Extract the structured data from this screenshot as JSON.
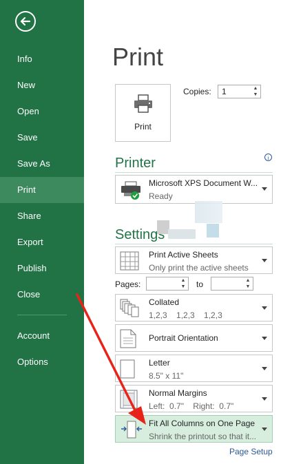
{
  "sidebar": {
    "items": [
      {
        "label": "Info"
      },
      {
        "label": "New"
      },
      {
        "label": "Open"
      },
      {
        "label": "Save"
      },
      {
        "label": "Save As"
      },
      {
        "label": "Print",
        "active": true
      },
      {
        "label": "Share"
      },
      {
        "label": "Export"
      },
      {
        "label": "Publish"
      },
      {
        "label": "Close"
      },
      {
        "label": "Account"
      },
      {
        "label": "Options"
      }
    ]
  },
  "page": {
    "title": "Print",
    "print_button": "Print",
    "copies_label": "Copies:",
    "copies_value": "1",
    "printer_heading": "Printer",
    "printer": {
      "name": "Microsoft XPS Document W...",
      "status": "Ready"
    },
    "settings_heading": "Settings",
    "print_what": {
      "main": "Print Active Sheets",
      "sub": "Only print the active sheets"
    },
    "pages_label": "Pages:",
    "to_label": "to",
    "pages_from": "",
    "pages_to": "",
    "collation": {
      "main": "Collated",
      "sub": "1,2,3    1,2,3    1,2,3"
    },
    "orientation": {
      "main": "Portrait Orientation"
    },
    "paper": {
      "main": "Letter",
      "sub": "8.5\" x 11\""
    },
    "margins": {
      "main": "Normal Margins",
      "sub": "Left:  0.7\"    Right:  0.7\""
    },
    "scaling": {
      "main": "Fit All Columns on One Page",
      "sub": "Shrink the printout so that it..."
    },
    "page_setup_link": "Page Setup"
  },
  "colors": {
    "sidebar_bg": "#217346",
    "sidebar_active": "#3d8a5f",
    "accent_green": "#217346",
    "highlight_bg": "#d7eedf",
    "annotation_arrow": "#e8231a",
    "link": "#2b579a"
  },
  "icons": [
    "back-arrow-icon",
    "printer-icon",
    "printer-ready-icon",
    "sheets-icon",
    "collated-icon",
    "portrait-icon",
    "letter-paper-icon",
    "margins-icon",
    "fit-columns-icon",
    "info-icon"
  ]
}
